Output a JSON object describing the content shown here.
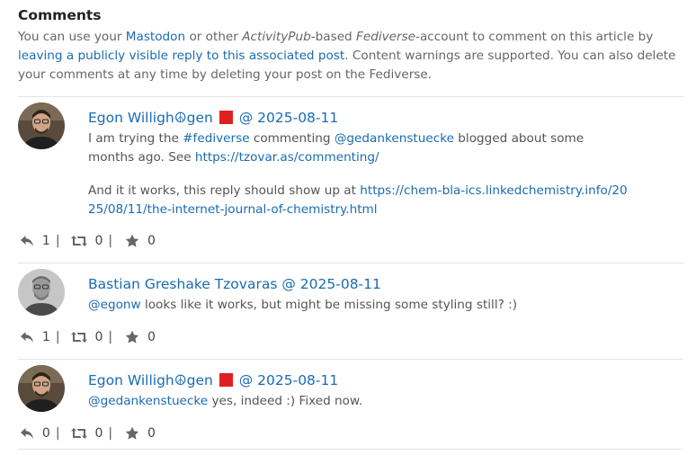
{
  "section": {
    "title": "Comments",
    "intro": {
      "t1": "You can use your ",
      "mastodon_link": "Mastodon",
      "t2": " or other ",
      "activitypub": "ActivityPub",
      "t3": "-based ",
      "fediverse": "Fediverse",
      "t4": "-account to comment on this article by ",
      "reply_link": "leaving a publicly visible reply to this associated post",
      "t5": ". Content warnings are supported. You can also delete your comments at any time by deleting your post on the Fediverse."
    }
  },
  "colors": {
    "link": "#1a6bb3",
    "flag": "#e02020",
    "separator": "#e4e4e4"
  },
  "comments": [
    {
      "name": "Egon Willigh☮gen",
      "sep": "@",
      "date": "2025-08-11",
      "p1": {
        "t1": "I am trying the ",
        "tag": "#fediverse",
        "t2": " commenting ",
        "mention": "@gedankenstuecke",
        "t3": " blogged about some months ago. See ",
        "link": "https://tzovar.as/commenting/"
      },
      "p2": {
        "t1": "And it it works, this reply should show up at ",
        "link": "https://chem-bla-ics.linkedchemistry.info/2025/08/11/the-internet-journal-of-chemistry.html"
      },
      "replies": "1",
      "boosts": "0",
      "favs": "0",
      "pipe": "|"
    },
    {
      "name": "Bastian Greshake Tzovaras",
      "sep": "@",
      "date": "2025-08-11",
      "mention": "@egonw",
      "text": " looks like it works, but might be missing some styling still? :)",
      "replies": "1",
      "boosts": "0",
      "favs": "0",
      "pipe": "|"
    },
    {
      "name": "Egon Willigh☮gen",
      "sep": "@",
      "date": "2025-08-11",
      "mention": "@gedankenstuecke",
      "text": " yes, indeed :) Fixed now.",
      "replies": "0",
      "boosts": "0",
      "favs": "0",
      "pipe": "|"
    }
  ],
  "icons": {
    "reply": "reply-icon",
    "boost": "boost-icon",
    "fav": "star-icon",
    "flag": "red-square-flag-icon"
  }
}
